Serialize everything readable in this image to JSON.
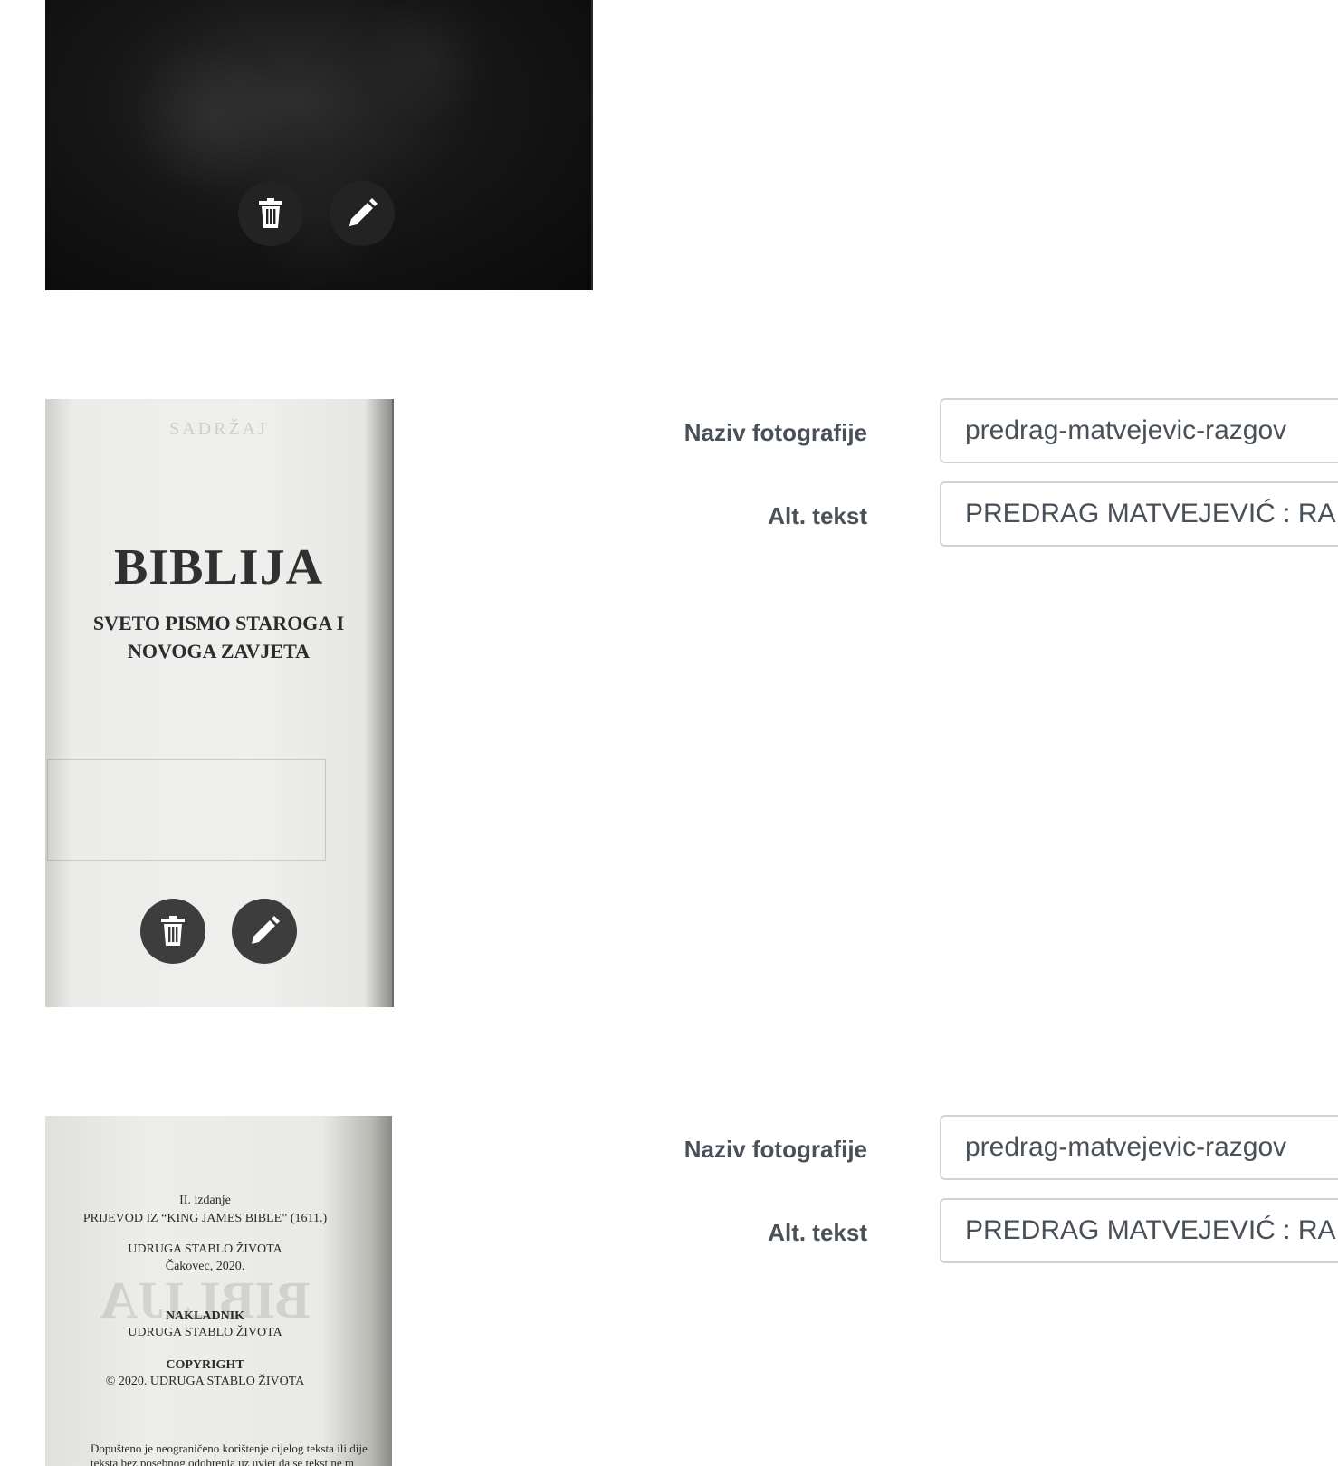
{
  "photos": [
    {
      "id": "photo-1",
      "actions": {
        "delete_icon": "trash-icon",
        "edit_icon": "pencil-icon"
      }
    },
    {
      "id": "photo-2",
      "book_text": {
        "heading_ghost": "SADRŽAJ",
        "title": "BIBLIJA",
        "subtitle_line1": "SVETO PISMO STAROGA I",
        "subtitle_line2": "NOVOGA ZAVJETA"
      },
      "fields": {
        "name_label": "Naziv fotografije",
        "name_value": "predrag-matvejevic-razgov",
        "alt_label": "Alt. tekst",
        "alt_value": "PREDRAG MATVEJEVIĆ : RA"
      },
      "actions": {
        "delete_icon": "trash-icon",
        "edit_icon": "pencil-icon"
      }
    },
    {
      "id": "photo-3",
      "book_text": {
        "line1": "II. izdanje",
        "line2": "PRIJEVOD IZ “KING JAMES BIBLE” (1611.)",
        "line3": "UDRUGA STABLO ŽIVOTA",
        "line4": "Čakovec, 2020.",
        "ghost": "BIBLIJA",
        "line5": "NAKLADNIK",
        "line6": "UDRUGA STABLO ŽIVOTA",
        "line7": "COPYRIGHT",
        "line8": "© 2020. UDRUGA STABLO ŽIVOTA",
        "line9": "Dopušteno je neograničeno korištenje cijelog teksta ili dije",
        "line10": "teksta bez posebnog odobrenja uz uvjet da se tekst ne m"
      },
      "fields": {
        "name_label": "Naziv fotografije",
        "name_value": "predrag-matvejevic-razgov",
        "alt_label": "Alt. tekst",
        "alt_value": "PREDRAG MATVEJEVIĆ : RA"
      }
    }
  ],
  "colors": {
    "button_bg": "#232323",
    "label_text": "#495057",
    "input_border": "#ced4da"
  }
}
